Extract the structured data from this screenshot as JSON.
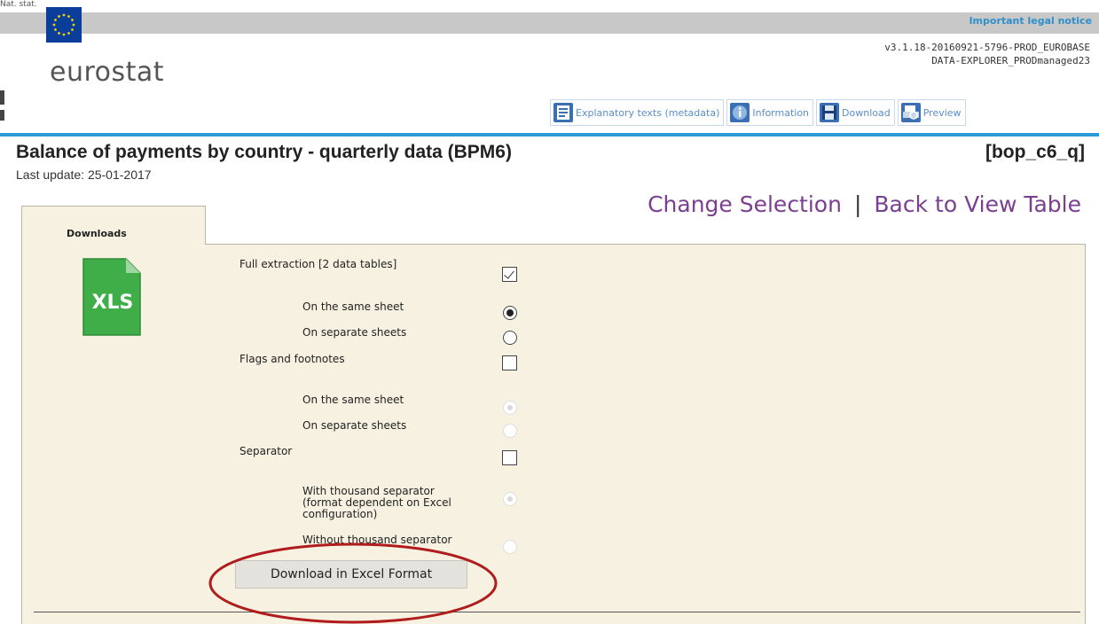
{
  "banner": {
    "top_strip_text": "Nat. stat.",
    "legal_notice": "Important legal notice",
    "logo_text": "eurostat",
    "version_line1": "v3.1.18-20160921-5796-PROD_EUROBASE",
    "version_line2": "DATA-EXPLORER_PRODmanaged23"
  },
  "toolbar": {
    "items": [
      {
        "label": "Explanatory texts (metadata)",
        "icon": "metadata-icon"
      },
      {
        "label": "Information",
        "icon": "info-icon"
      },
      {
        "label": "Download",
        "icon": "floppy-disk-icon"
      },
      {
        "label": "Preview",
        "icon": "print-preview-icon"
      }
    ]
  },
  "heading": {
    "title": "Balance of payments by country - quarterly data (BPM6)",
    "code": "[bop_c6_q]",
    "last_update": "Last update: 25-01-2017"
  },
  "nav": {
    "change_selection": "Change Selection",
    "separator": "|",
    "back_to_view": "Back to View Table"
  },
  "downloads": {
    "tab_label": "Downloads",
    "file_icon_text": "XLS",
    "full_extraction": "Full extraction [2 data tables]",
    "full_same_sheet": "On the same sheet",
    "full_separate_sheets": "On separate sheets",
    "flags_footnotes": "Flags and footnotes",
    "flags_same_sheet": "On the same sheet",
    "flags_separate_sheets": "On separate sheets",
    "separator": "Separator",
    "with_thousand_line1": "With thousand separator",
    "with_thousand_line2": "(format dependent on Excel",
    "with_thousand_line3": "configuration)",
    "without_thousand": "Without thousand separator",
    "button_label": "Download in Excel Format",
    "state": {
      "full_extraction_checked": true,
      "full_option": "On the same sheet",
      "flags_checked": false,
      "separator_checked": false
    }
  },
  "colors": {
    "accent_blue": "#2d9bd6",
    "nav_purple": "#7b3f91",
    "panel_bg": "#f6f1e1",
    "annotation_red": "#b01c1c"
  }
}
